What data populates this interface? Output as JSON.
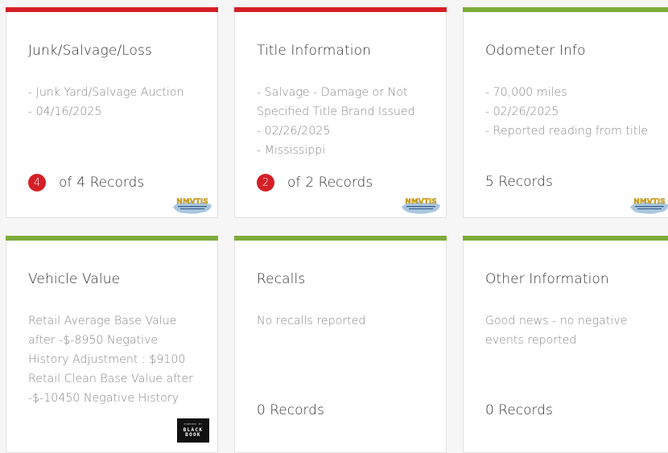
{
  "colors": {
    "red": "#d41f26",
    "green": "#7dac3a"
  },
  "cards": [
    {
      "title": "Junk/Salvage/Loss",
      "lines": [
        "- Junk Yard/Salvage Auction",
        "- 04/16/2025"
      ],
      "badge": "4",
      "of": "of",
      "records": "4 Records",
      "logo": "NMVTIS"
    },
    {
      "title": "Title Information",
      "lines": [
        "- Salvage - Damage or Not",
        "Specified Title Brand Issued",
        "- 02/26/2025",
        "- Mississippi"
      ],
      "badge": "2",
      "of": "of",
      "records": "2 Records",
      "logo": "NMVTIS"
    },
    {
      "title": "Odometer Info",
      "lines": [
        "- 70,000 miles",
        "- 02/26/2025",
        "- Reported reading from title"
      ],
      "records": "5 Records",
      "logo": "NMVTIS"
    },
    {
      "title": "Vehicle Value",
      "lines": [
        "Retail Average Base Value",
        "after -$-8950 Negative",
        "History Adjustment : $9100",
        "Retail Clean Base Value after",
        "-$-10450 Negative History"
      ],
      "logo_small": "POWERED BY",
      "logo_big_1": "BLACK",
      "logo_big_2": "BOOK"
    },
    {
      "title": "Recalls",
      "lines": [
        "No recalls reported"
      ],
      "records": "0 Records"
    },
    {
      "title": "Other Information",
      "lines": [
        "Good news - no negative",
        "events reported"
      ],
      "records": "0 Records"
    }
  ]
}
